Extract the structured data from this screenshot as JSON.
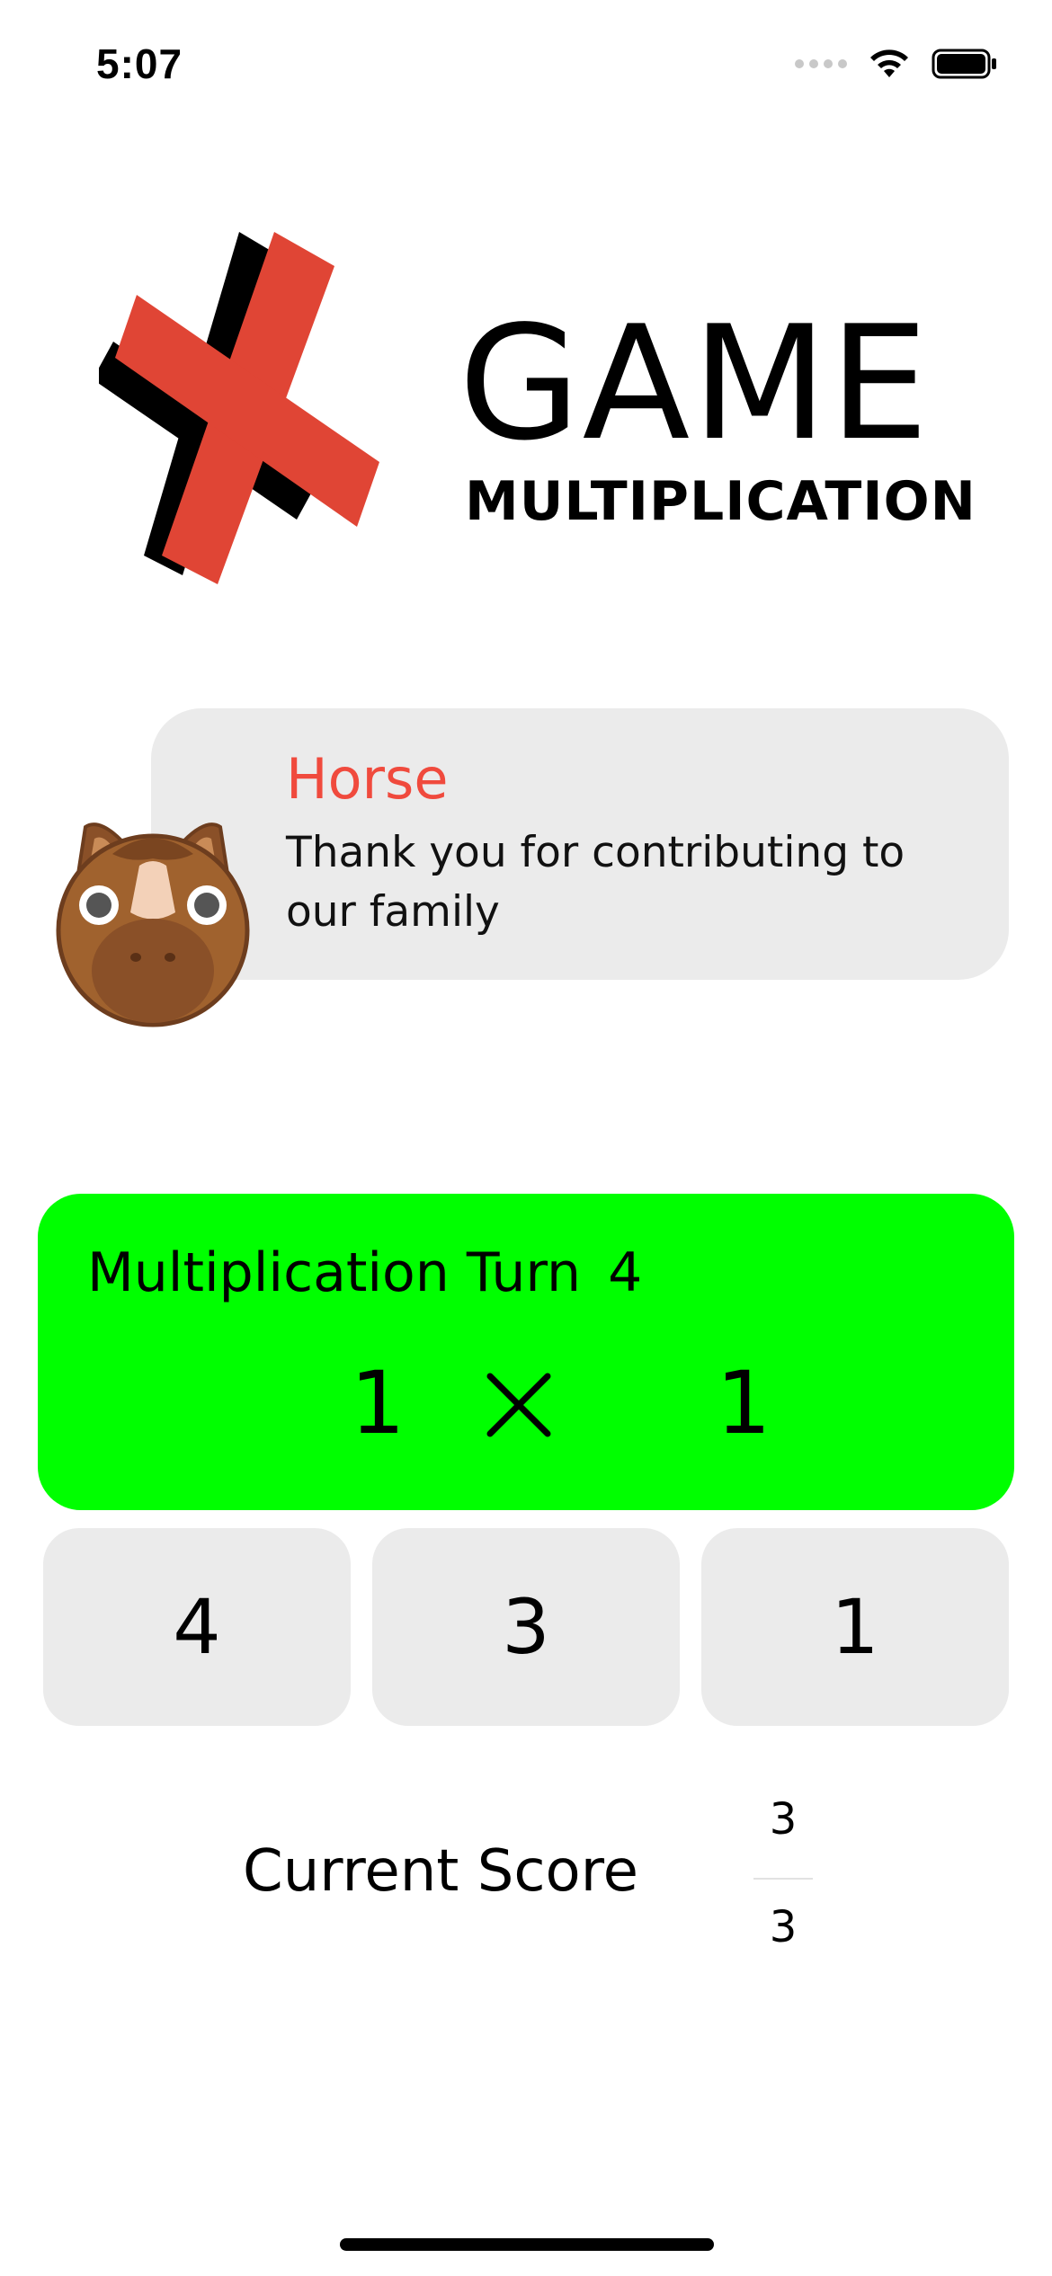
{
  "status_bar": {
    "time": "5:07",
    "icons": [
      "signal-dots-icon",
      "wifi-icon",
      "battery-icon"
    ]
  },
  "logo": {
    "title": "GAME",
    "subtitle": "MULTIPLICATION",
    "mark_icon": "multiplication-cross-icon",
    "mark_color": "#e04535"
  },
  "message": {
    "name": "Horse",
    "text": "Thank you for contributing to our family",
    "avatar_icon": "horse-avatar-icon",
    "name_color": "#f04a3d"
  },
  "question": {
    "turn_label": "Multiplication Turn",
    "turn_number": "4",
    "left_operand": "1",
    "operator_icon": "multiply-icon",
    "right_operand": "1",
    "background_color": "#00ff00"
  },
  "answers": [
    {
      "label": "4"
    },
    {
      "label": "3"
    },
    {
      "label": "1"
    }
  ],
  "score": {
    "label": "Current Score",
    "numerator": "3",
    "denominator": "3"
  }
}
